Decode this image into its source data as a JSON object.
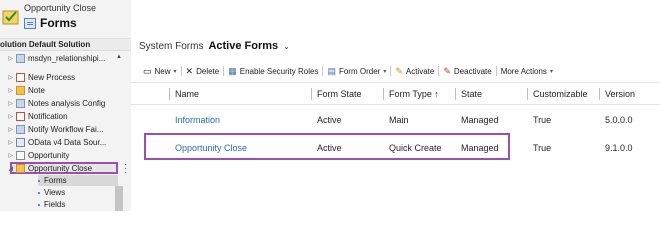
{
  "colors": {
    "accent_highlight": "#9b4fb0",
    "link": "#2c6bb3"
  },
  "left_panel": {
    "subtitle": "Opportunity Close",
    "title": "Forms",
    "solution_label": "olution Default Solution",
    "tree_items": [
      {
        "label": "msdyn_relationshipi...",
        "icon": "entity-icon"
      },
      {
        "label": "New Process",
        "icon": "flag-icon"
      },
      {
        "label": "Note",
        "icon": "folder-icon"
      },
      {
        "label": "Notes analysis Config",
        "icon": "entity-icon"
      },
      {
        "label": "Notification",
        "icon": "flag-icon"
      },
      {
        "label": "Notify Workflow Fai...",
        "icon": "entity-icon"
      },
      {
        "label": "OData v4 Data Sour...",
        "icon": "table-icon"
      },
      {
        "label": "Opportunity",
        "icon": "doc-icon"
      },
      {
        "label": "Opportunity Close",
        "icon": "folder-icon"
      }
    ],
    "sub_items": [
      {
        "label": "Forms",
        "icon": "forms-icon"
      },
      {
        "label": "Views",
        "icon": "views-icon"
      },
      {
        "label": "Fields",
        "icon": "fields-icon"
      }
    ]
  },
  "main": {
    "view_prefix": "System Forms",
    "view_name": "Active Forms",
    "toolbar": {
      "new": "New",
      "delete": "Delete",
      "security": "Enable Security Roles",
      "form_order": "Form Order",
      "activate": "Activate",
      "deactivate": "Deactivate",
      "more": "More Actions"
    },
    "columns": [
      "Name",
      "Form State",
      "Form Type ↑",
      "State",
      "Customizable",
      "Version"
    ],
    "rows": [
      {
        "name": "Information",
        "form_state": "Active",
        "form_type": "Main",
        "state": "Managed",
        "customizable": "True",
        "version": "5.0.0.0"
      },
      {
        "name": "Opportunity Close",
        "form_state": "Active",
        "form_type": "Quick Create",
        "state": "Managed",
        "customizable": "True",
        "version": "9.1.0.0"
      }
    ]
  }
}
